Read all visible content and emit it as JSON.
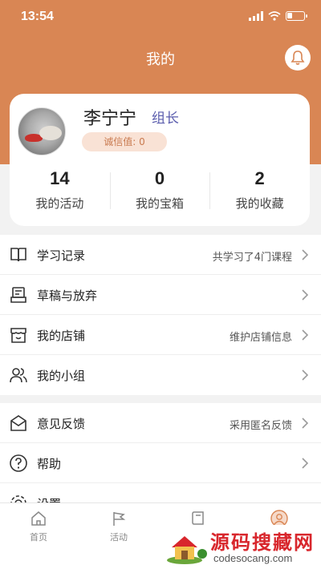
{
  "status": {
    "time": "13:54"
  },
  "header": {
    "title": "我的",
    "bell_icon": "bell-icon"
  },
  "profile": {
    "name": "李宁宁",
    "role": "组长",
    "credit": "诚信值: 0",
    "stats": [
      {
        "value": "14",
        "label": "我的活动"
      },
      {
        "value": "0",
        "label": "我的宝箱"
      },
      {
        "value": "2",
        "label": "我的收藏"
      }
    ]
  },
  "menu_group_1": [
    {
      "label": "学习记录",
      "value": "共学习了4门课程",
      "icon": "book-icon"
    },
    {
      "label": "草稿与放弃",
      "value": "",
      "icon": "draft-icon"
    },
    {
      "label": "我的店铺",
      "value": "维护店铺信息",
      "icon": "shop-icon"
    },
    {
      "label": "我的小组",
      "value": "",
      "icon": "group-icon"
    }
  ],
  "menu_group_2": [
    {
      "label": "意见反馈",
      "value": "采用匿名反馈",
      "icon": "mail-icon"
    },
    {
      "label": "帮助",
      "value": "",
      "icon": "help-icon"
    },
    {
      "label": "设置",
      "value": "",
      "icon": "gear-icon"
    }
  ],
  "tabbar": [
    {
      "label": "首页",
      "icon": "home-icon"
    },
    {
      "label": "活动",
      "icon": "flag-icon"
    },
    {
      "label": "",
      "icon": "book-icon"
    },
    {
      "label": "",
      "icon": "user-icon"
    }
  ],
  "watermark": {
    "title": "源码搜藏网",
    "url": "codesocang.com"
  },
  "colors": {
    "accent": "#d98654",
    "role": "#5a5cad",
    "credit_bg": "#f9e2d5"
  }
}
